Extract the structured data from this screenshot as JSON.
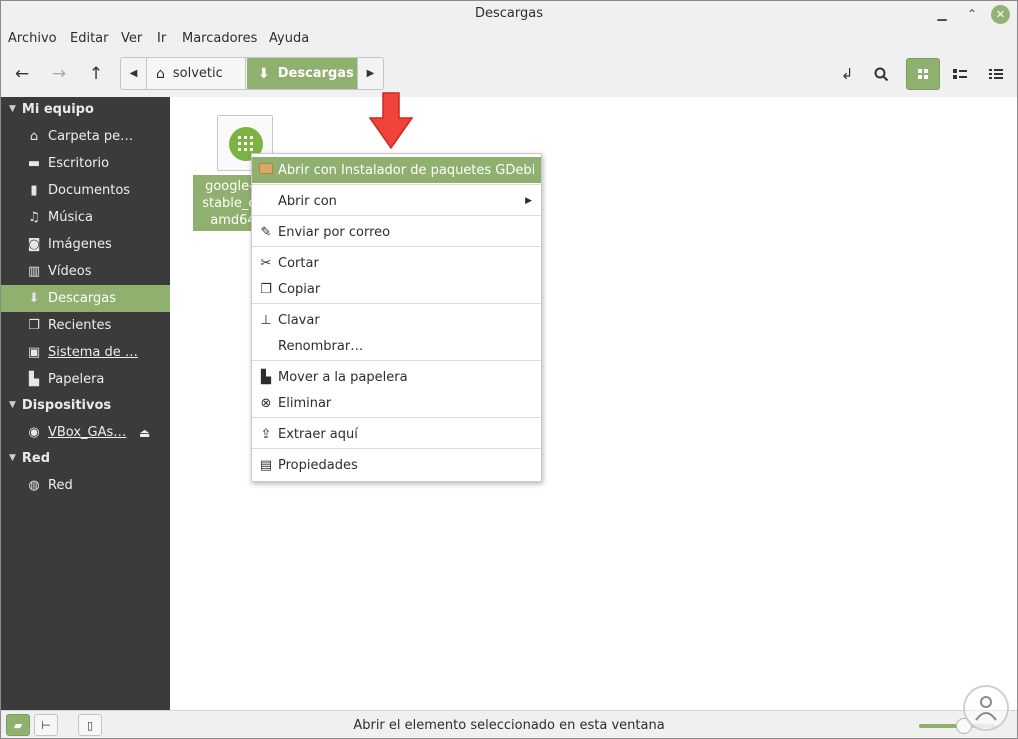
{
  "window": {
    "title": "Descargas"
  },
  "menubar": {
    "items": [
      "Archivo",
      "Editar",
      "Ver",
      "Ir",
      "Marcadores",
      "Ayuda"
    ]
  },
  "toolbar": {
    "back_icon": "arrow-left-icon",
    "forward_icon": "arrow-right-icon",
    "up_icon": "arrow-up-icon",
    "path": [
      "solvetic",
      "Descargas"
    ],
    "accent": "#8fb06e"
  },
  "sidebar": {
    "sections": [
      {
        "title": "Mi equipo",
        "items": [
          {
            "label": "Carpeta pe…",
            "icon": "home-icon"
          },
          {
            "label": "Escritorio",
            "icon": "desktop-icon"
          },
          {
            "label": "Documentos",
            "icon": "documents-icon"
          },
          {
            "label": "Música",
            "icon": "music-icon"
          },
          {
            "label": "Imágenes",
            "icon": "camera-icon"
          },
          {
            "label": "Vídeos",
            "icon": "film-icon"
          },
          {
            "label": "Descargas",
            "icon": "download-icon",
            "active": true
          },
          {
            "label": "Recientes",
            "icon": "recent-icon"
          },
          {
            "label": "Sistema de …",
            "icon": "drive-icon"
          },
          {
            "label": "Papelera",
            "icon": "trash-icon"
          }
        ]
      },
      {
        "title": "Dispositivos",
        "items": [
          {
            "label": "VBox_GAs…",
            "icon": "disc-icon"
          }
        ]
      },
      {
        "title": "Red",
        "items": [
          {
            "label": "Red",
            "icon": "network-icon"
          }
        ]
      }
    ]
  },
  "file": {
    "line1": "google-c",
    "line2": "stable_cu",
    "line3": "amd64"
  },
  "context_menu": {
    "items": [
      "Abrir con Instalador de paquetes GDebi",
      "Abrir con",
      "Enviar por correo",
      "Cortar",
      "Copiar",
      "Clavar",
      "Renombrar…",
      "Mover a la papelera",
      "Eliminar",
      "Extraer aquí",
      "Propiedades"
    ]
  },
  "statusbar": {
    "text": "Abrir el elemento seleccionado en esta ventana",
    "zoom_level": 0.6
  }
}
